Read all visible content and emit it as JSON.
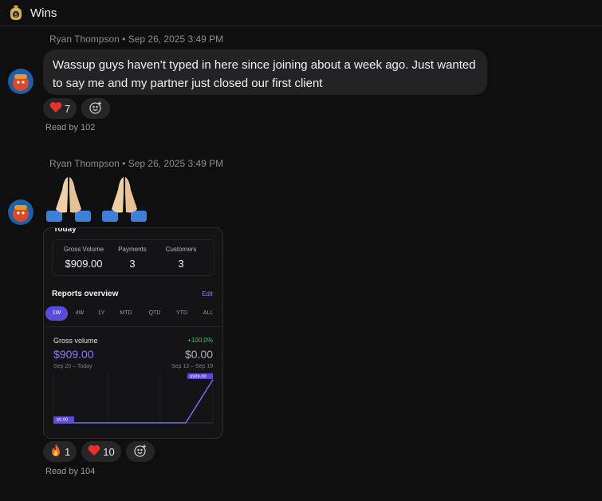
{
  "channel": {
    "title": "Wins",
    "icon": "money-bag-icon"
  },
  "messages": [
    {
      "author": "Ryan Thompson",
      "timestamp": "Sep 26, 2025 3:49 PM",
      "text": "Wassup guys haven’t typed in here since joining about a week ago. Just wanted to say me and my partner just closed our first client",
      "reactions": [
        {
          "emoji": "heart",
          "count": "7"
        }
      ],
      "read_by": "Read by 102"
    },
    {
      "author": "Ryan Thompson",
      "timestamp": "Sep 26, 2025 3:49 PM",
      "emojis": [
        "folded-hands",
        "folded-hands"
      ],
      "reactions": [
        {
          "emoji": "fire",
          "count": "1"
        },
        {
          "emoji": "heart",
          "count": "10"
        }
      ],
      "read_by": "Read by 104",
      "attachment": {
        "today_label": "Today",
        "stats": [
          {
            "label": "Gross Volume",
            "value": "$909.00"
          },
          {
            "label": "Payments",
            "value": "3"
          },
          {
            "label": "Customers",
            "value": "3"
          }
        ],
        "reports_title": "Reports overview",
        "edit_label": "Edit",
        "periods": [
          "1W",
          "4W",
          "1Y",
          "MTD",
          "QTD",
          "YTD",
          "ALL"
        ],
        "active_period": "1W",
        "gross_volume_label": "Gross volume",
        "change": "+100.0%",
        "current_value": "$909.00",
        "previous_value": "$0.00",
        "current_range": "Sep 20 – Today",
        "previous_range": "Sep 13 – Sep 19",
        "chart_start_label": "$0.00",
        "chart_end_label": "$909.00",
        "colors": {
          "accent": "#5b4bdb",
          "positive": "#4fbf6a"
        }
      }
    }
  ]
}
